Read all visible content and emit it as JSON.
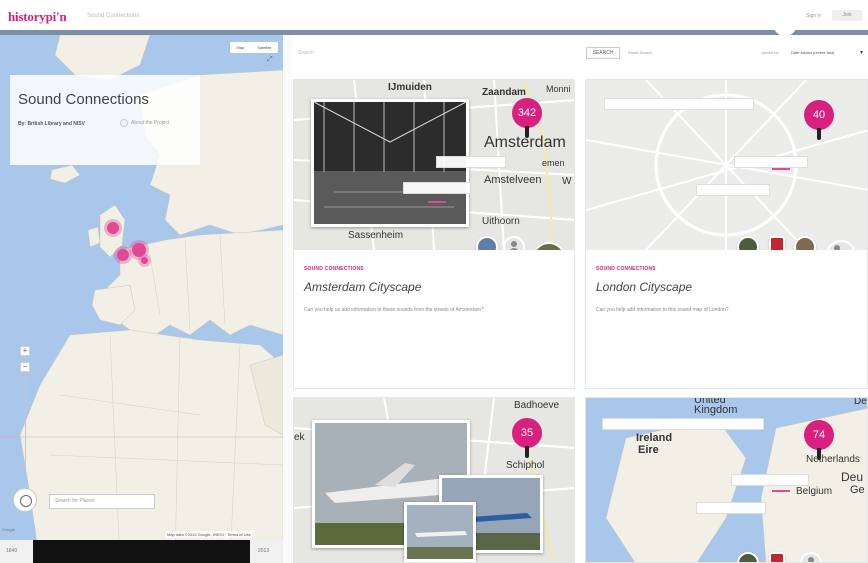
{
  "header": {
    "brand": "historypi'n",
    "subtitle": "Sound Connections",
    "signin_label": "Sign in",
    "join_label": "Join"
  },
  "map": {
    "type_options": [
      "Map",
      "Satellite"
    ],
    "fullscreen_glyph": "⤢",
    "info_title": "Sound Connections",
    "info_byline": "By: British Library and NISV",
    "info_about_label": "About the Project",
    "search_placeholder": "Search for Places",
    "footer_left": "Google",
    "footer_right": "Map data ©2013 Google, INEGI  ·  Terms of Use",
    "zoom_in": "+",
    "zoom_out": "−",
    "timeline_left": "1840",
    "timeline_right": "2013"
  },
  "toolbar": {
    "search_placeholder": "Search",
    "search_button": "SEARCH",
    "reset_link": "Reset Search",
    "sorted_by_label": "sorted by:",
    "sort_value": "Date Added (recent first)"
  },
  "cards": [
    {
      "marker_count": "342",
      "place_labels": [
        "IJmuiden",
        "Zaandam",
        "Monni",
        "Amsterdam",
        "emen",
        "Amstelveen",
        "W",
        "Uithoorn",
        "Sassenheim"
      ],
      "tag": "SOUND CONNECTIONS",
      "title": "Amsterdam Cityscape",
      "description": "Can you help us add information to these sounds from the streets of Amsterdam?"
    },
    {
      "marker_count": "40",
      "place_labels": [],
      "tag": "SOUND CONNECTIONS",
      "title": "London Cityscape",
      "description": "Can you help add information to this sound map of London?"
    },
    {
      "marker_count": "35",
      "place_labels": [
        "Badhoeve",
        "ek",
        "Schiphol"
      ],
      "tag": "",
      "title": "",
      "description": ""
    },
    {
      "marker_count": "74",
      "place_labels": [
        "United",
        "Kingdom",
        "Ireland",
        "Eire",
        "Netherlands",
        "Deu",
        "Belgium",
        "Ge",
        "De"
      ],
      "tag": "",
      "title": "",
      "description": ""
    }
  ],
  "colors": {
    "brand_pink": "#d8207e",
    "map_water": "#a9c7ea",
    "map_land": "#f2efe6"
  }
}
